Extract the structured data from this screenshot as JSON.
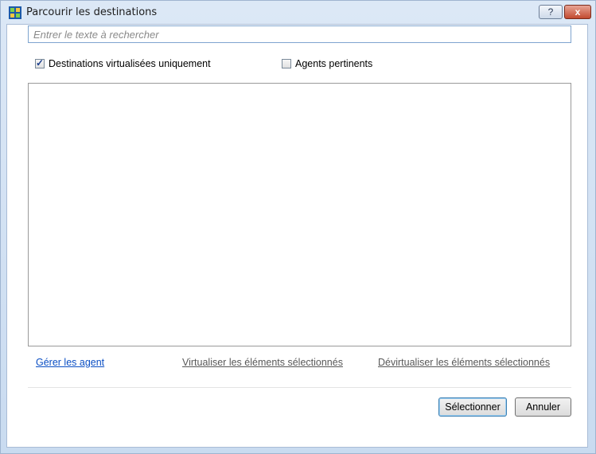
{
  "window": {
    "title": "Parcourir les destinations",
    "help_label": "?",
    "close_label": "x"
  },
  "search": {
    "placeholder": "Entrer le texte à rechercher"
  },
  "filters": {
    "virtualized_only_label": "Destinations virtualisées uniquement",
    "virtualized_only_checked": true,
    "relevant_agents_label": "Agents pertinents",
    "relevant_agents_checked": false
  },
  "links": {
    "manage_agents": "Gérer les agent",
    "virtualize_selected": "Virtualiser les éléments sélectionnés",
    "devirtualize_selected": "Dévirtualiser les éléments sélectionnés"
  },
  "buttons": {
    "select": "Sélectionner",
    "cancel": "Annuler"
  },
  "colors": {
    "link_active": "#0b4fc4",
    "link_disabled": "#585858",
    "close_red": "#c24a2f"
  }
}
